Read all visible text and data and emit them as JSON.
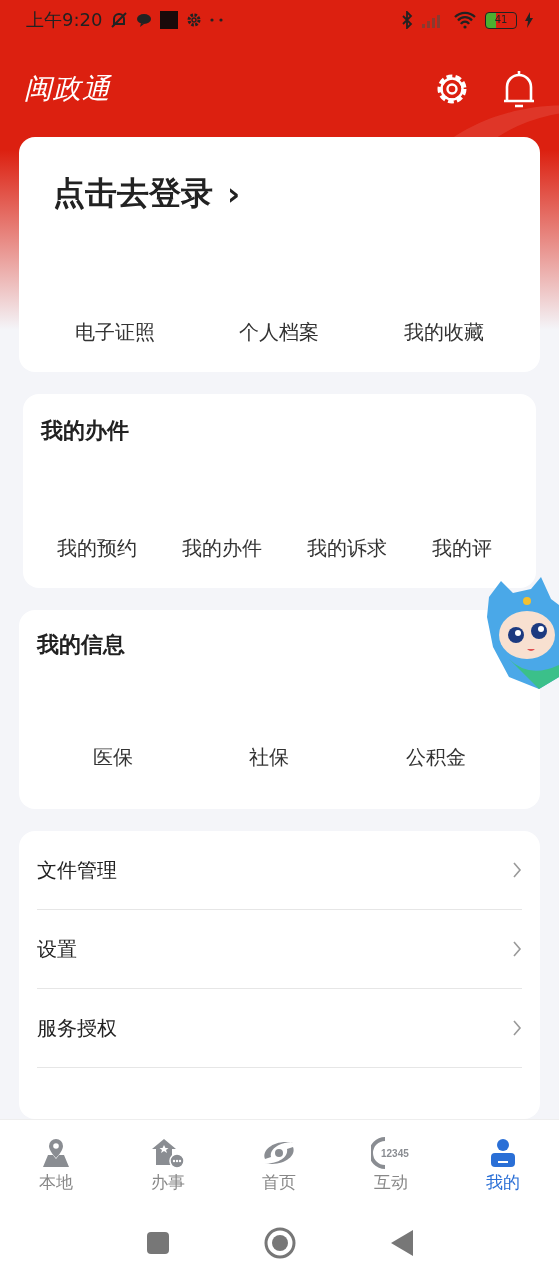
{
  "status_bar": {
    "time": "上午9:20",
    "battery": "41"
  },
  "header": {
    "logo": "闽政通"
  },
  "login_card": {
    "title": "点击去登录",
    "chevron": "›",
    "links": [
      "电子证照",
      "个人档案",
      "我的收藏"
    ]
  },
  "affairs_card": {
    "title": "我的办件",
    "items": [
      "我的预约",
      "我的办件",
      "我的诉求",
      "我的评"
    ]
  },
  "info_card": {
    "title": "我的信息",
    "items": [
      "医保",
      "社保",
      "公积金"
    ]
  },
  "menu": [
    {
      "label": "文件管理"
    },
    {
      "label": "设置"
    },
    {
      "label": "服务授权"
    }
  ],
  "tabs": [
    {
      "label": "本地",
      "kind": "map",
      "selected": false
    },
    {
      "label": "办事",
      "kind": "house",
      "selected": false
    },
    {
      "label": "首页",
      "kind": "eye",
      "selected": false
    },
    {
      "label": "互动",
      "kind": "hotline",
      "icon_text": "12345",
      "selected": false
    },
    {
      "label": "我的",
      "kind": "person",
      "selected": true
    }
  ]
}
